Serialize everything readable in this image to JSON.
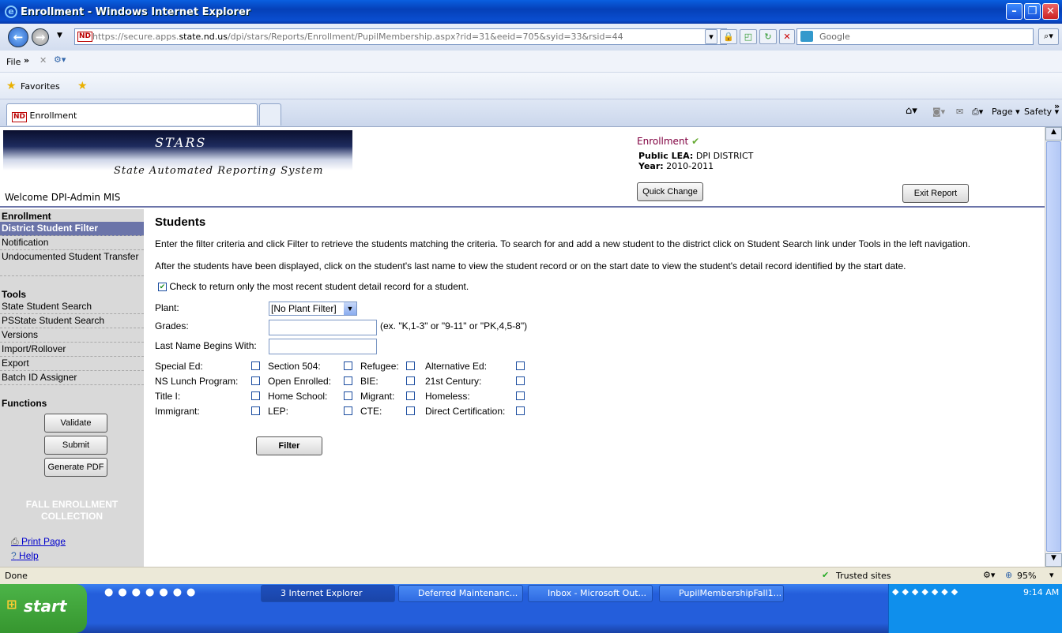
{
  "window": {
    "title": "Enrollment - Windows Internet Explorer"
  },
  "address": {
    "url_prefix": "https://secure.apps.",
    "url_host": "state.nd.us",
    "url_path": "/dpi/stars/Reports/Enrollment/PupilMembership.aspx?rid=31&eeid=705&syid=33&rsid=44",
    "search_placeholder": "Google"
  },
  "menubar": {
    "file": "File"
  },
  "favbar": {
    "favorites": "Favorites"
  },
  "tabbar": {
    "tab_label": "Enrollment",
    "page": "Page ▾",
    "safety": "Safety ▾"
  },
  "banner": {
    "title": "STARS",
    "subtitle": "State Automated Reporting System",
    "welcome": "Welcome DPI-Admin MIS"
  },
  "header": {
    "module": "Enrollment",
    "lea_label": "Public LEA:",
    "lea_value": "DPI DISTRICT",
    "year_label": "Year:",
    "year_value": "2010-2011",
    "quick_change": "Quick Change",
    "exit_report": "Exit Report"
  },
  "nav": {
    "enrollment_heading": "Enrollment",
    "enrollment_items": [
      "District Student Filter",
      "Notification",
      "Undocumented Student Transfer"
    ],
    "tools_heading": "Tools",
    "tools_items": [
      "State Student Search",
      "PSState Student Search",
      "Versions",
      "Import/Rollover",
      "Export",
      "Batch ID Assigner"
    ],
    "functions_heading": "Functions",
    "validate": "Validate",
    "submit": "Submit",
    "generate_pdf": "Generate PDF",
    "collection": "FALL ENROLLMENT COLLECTION",
    "print_page": "Print Page",
    "help": "Help"
  },
  "main": {
    "heading": "Students",
    "intro1": "Enter the filter criteria and click Filter to retrieve the students matching the criteria. To search for and add a new student to the district click on Student Search link under Tools in the left navigation.",
    "intro2": "After the students have been displayed, click on the student's last name to view the student record or on the start date to view the student's detail record identified by the start date.",
    "recent_check": "Check to return only the most recent student detail record for a student.",
    "plant_label": "Plant:",
    "plant_value": "[No Plant Filter]",
    "grades_label": "Grades:",
    "grades_hint": "(ex. \"K,1-3\" or \"9-11\" or \"PK,4,5-8\")",
    "lastname_label": "Last Name Begins With:",
    "flags": [
      [
        "Special Ed:",
        "Section 504:",
        "Refugee:",
        "Alternative Ed:"
      ],
      [
        "NS Lunch Program:",
        "Open Enrolled:",
        "BIE:",
        "21st Century:"
      ],
      [
        "Title I:",
        "Home School:",
        "Migrant:",
        "Homeless:"
      ],
      [
        "Immigrant:",
        "LEP:",
        "CTE:",
        "Direct Certification:"
      ]
    ],
    "filter_button": "Filter"
  },
  "status": {
    "left": "Done",
    "zone": "Trusted sites",
    "zoom": "95%"
  },
  "taskbar": {
    "start": "start",
    "items": [
      "3 Internet Explorer",
      "Deferred Maintenanc...",
      "Inbox - Microsoft Out...",
      "PupilMembershipFall1..."
    ],
    "time": "9:14 AM"
  }
}
